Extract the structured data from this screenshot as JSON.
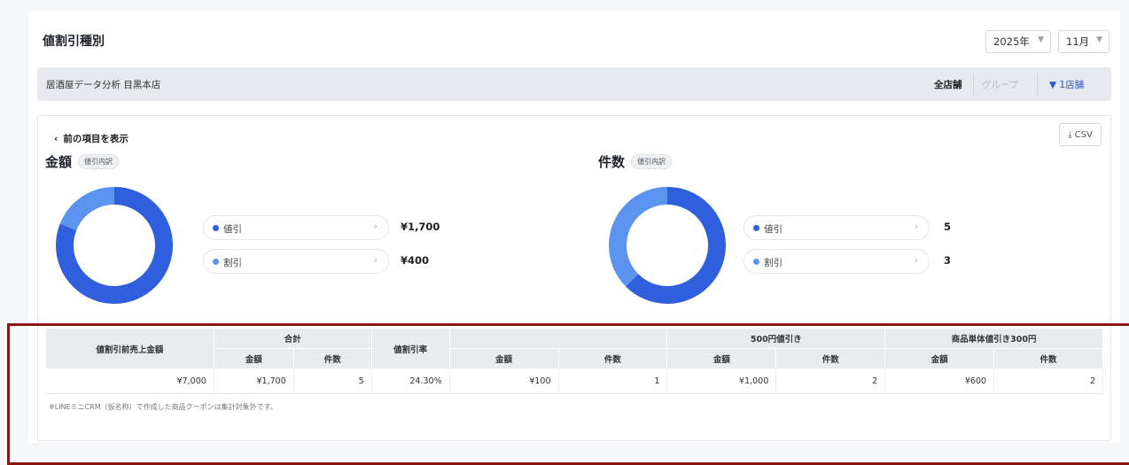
{
  "header": {
    "title": "値割引種別",
    "year_select": "2025年",
    "month_select": "11月"
  },
  "store_bar": {
    "store_name": "居酒屋データ分析 目黒本店",
    "segments": [
      "全店舗",
      "グループ",
      "1店舗"
    ]
  },
  "card": {
    "back_label": "前の項目を表示",
    "csv_label": "CSV",
    "amount_section": {
      "title": "金額",
      "tag": "値引内訳"
    },
    "count_section": {
      "title": "件数",
      "tag": "値引内訳"
    },
    "amount_legend": [
      {
        "label": "値引",
        "value": "¥1,700"
      },
      {
        "label": "割引",
        "value": "¥400"
      }
    ],
    "count_legend": [
      {
        "label": "値引",
        "value": "5"
      },
      {
        "label": "割引",
        "value": "3"
      }
    ]
  },
  "chart_data": [
    {
      "type": "pie",
      "categories": [
        "値引",
        "割引"
      ],
      "values": [
        1700,
        400
      ],
      "colors": [
        "#2f5fdc",
        "#5b93ef"
      ]
    },
    {
      "type": "pie",
      "categories": [
        "値引",
        "割引"
      ],
      "values": [
        5,
        3
      ],
      "colors": [
        "#2f5fdc",
        "#5b93ef"
      ]
    }
  ],
  "table": {
    "col_pre_sales": "値割引前売上金額",
    "col_total": "合計",
    "col_rate": "値割引率",
    "col_group_blank": "",
    "col_500": "500円値引き",
    "col_item300": "商品単体値引き300円",
    "sub_amount": "金額",
    "sub_count": "件数",
    "row": [
      "¥7,000",
      "¥1,700",
      "5",
      "24.30%",
      "¥100",
      "1",
      "¥1,000",
      "2",
      "¥600",
      "2"
    ],
    "note": "※LINEミニCRM（仮名称）で作成した商品クーポンは集計対象外です。"
  },
  "colors": {
    "primary": "#2f5fdc",
    "secondary": "#5b93ef",
    "filter": "#2a56c6",
    "frame": "#8b1414"
  }
}
